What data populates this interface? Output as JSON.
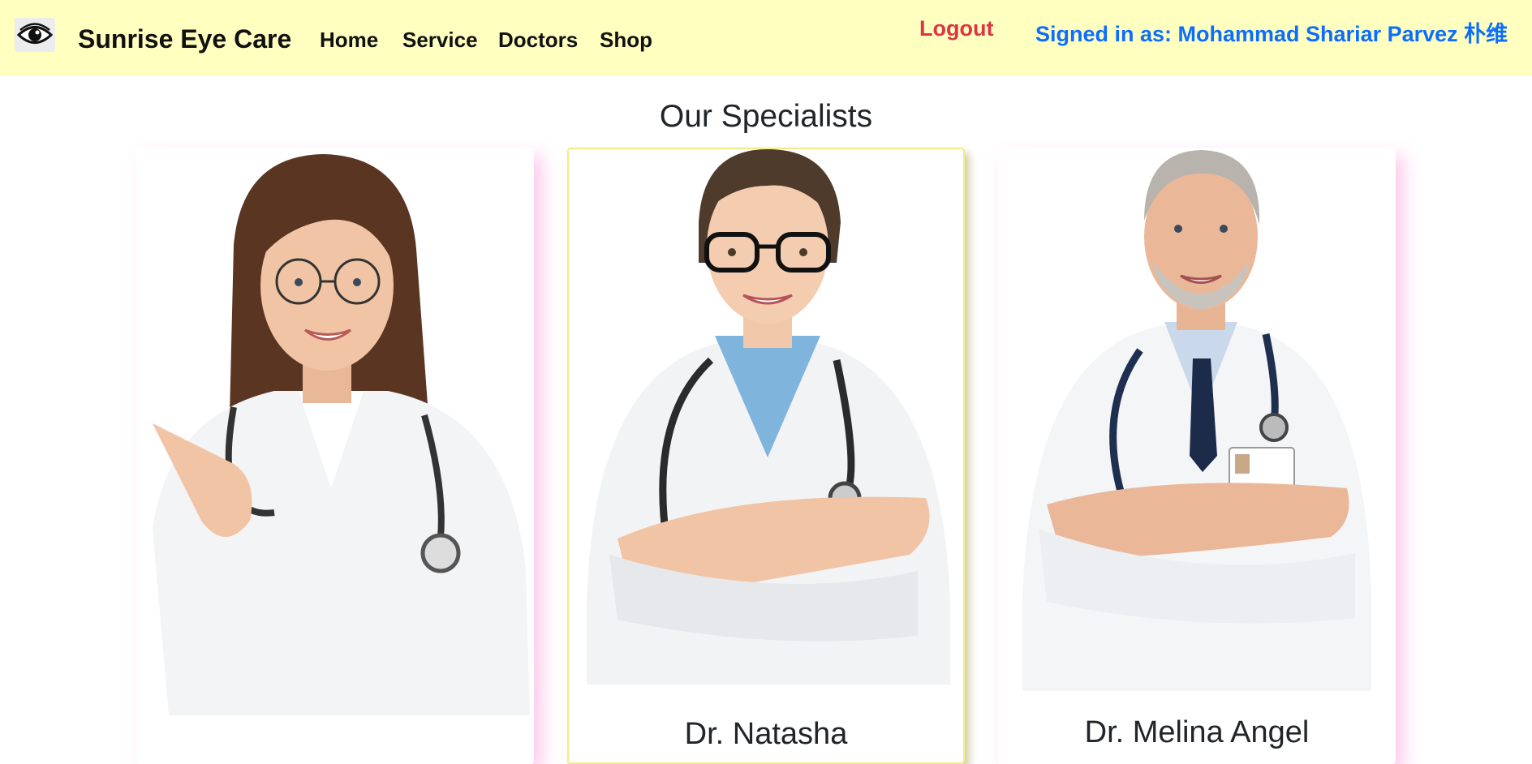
{
  "brand": {
    "name": "Sunrise Eye Care",
    "logo_icon": "eye-icon"
  },
  "nav": {
    "items": [
      "Home",
      "Service",
      "Doctors",
      "Shop"
    ]
  },
  "auth": {
    "logout_label": "Logout",
    "signed_in_text": "Signed in as: Mohammad Shariar Parvez 朴维"
  },
  "section": {
    "title": "Our Specialists"
  },
  "doctors": [
    {
      "name": "",
      "photo": "female-doctor-pointing-photo"
    },
    {
      "name": "Dr. Natasha",
      "photo": "female-doctor-arms-crossed-photo"
    },
    {
      "name": "Dr. Melina Angel",
      "photo": "male-doctor-arms-crossed-photo"
    }
  ],
  "colors": {
    "navbar_bg": "#ffffc0",
    "logout": "#dc3545",
    "signed_in": "#0d6efd",
    "card_active_border": "#f0ec8a",
    "card_shadow": "#ff64c8"
  }
}
